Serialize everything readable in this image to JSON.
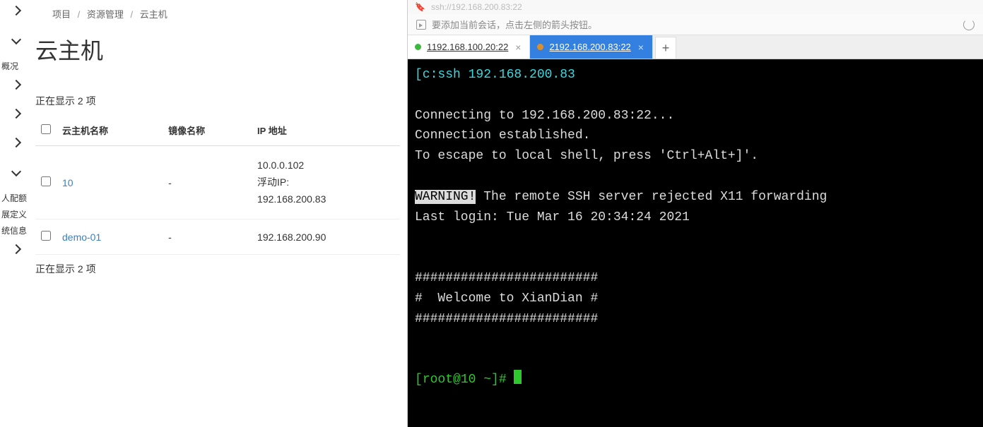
{
  "sidebar": {
    "label_overview": "概况",
    "label_quota": "人配额",
    "label_definition": "展定义",
    "label_sysinfo": "统信息"
  },
  "breadcrumb": {
    "item1": "项目",
    "item2": "资源管理",
    "item3": "云主机"
  },
  "page_title": "云主机",
  "list_info_top": "正在显示 2 项",
  "list_info_bottom": "正在显示 2 项",
  "table": {
    "col_name": "云主机名称",
    "col_image": "镜像名称",
    "col_ip": "IP 地址",
    "rows": [
      {
        "name": "10",
        "image": "-",
        "ip_line1": "10.0.0.102",
        "ip_line2": "浮动IP:",
        "ip_line3": "192.168.200.83"
      },
      {
        "name": "demo-01",
        "image": "-",
        "ip_line1": "192.168.200.90",
        "ip_line2": "",
        "ip_line3": ""
      }
    ]
  },
  "terminal": {
    "addr_bar": "ssh://192.168.200.83:22",
    "hint_text": "要添加当前会话，点击左侧的箭头按钮。",
    "tabs": [
      {
        "index": "1",
        "label": "192.168.100.20:22"
      },
      {
        "index": "2",
        "label": "192.168.200.83:22"
      }
    ],
    "active_tab": 1,
    "lines": {
      "cmd": "[c:ssh 192.168.200.83",
      "blank1": "",
      "connecting": "Connecting to 192.168.200.83:22...",
      "established": "Connection established.",
      "escape": "To escape to local shell, press 'Ctrl+Alt+]'.",
      "blank2": "",
      "warning_tag": "WARNING!",
      "warning_rest": " The remote SSH server rejected X11 forwarding",
      "last_login": "Last login: Tue Mar 16 20:34:24 2021",
      "banner1": "########################",
      "banner2": "#  Welcome to XianDian #",
      "banner3": "########################",
      "prompt_open": "[",
      "prompt_user": "root@10",
      "prompt_rest": " ~]# "
    }
  }
}
